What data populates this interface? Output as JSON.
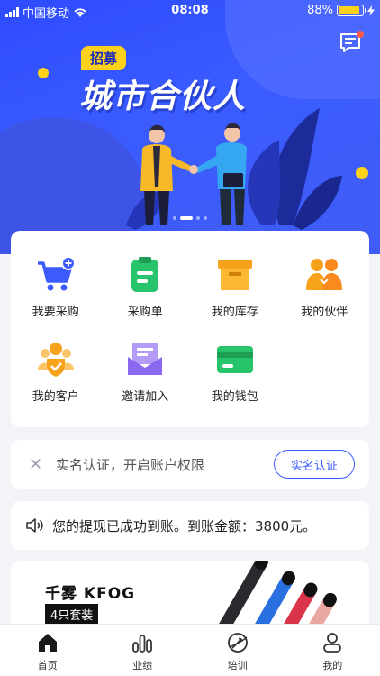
{
  "status_bar": {
    "carrier": "中国移动",
    "time": "08:08",
    "battery": "88%"
  },
  "banner": {
    "tag": "招募",
    "headline": "城市合伙人",
    "slide_count": 4,
    "active_slide": 1
  },
  "menu": {
    "items": [
      {
        "label": "我要采购",
        "icon": "shopping-cart-plus-icon"
      },
      {
        "label": "采购单",
        "icon": "clipboard-list-icon"
      },
      {
        "label": "我的库存",
        "icon": "inventory-box-icon"
      },
      {
        "label": "我的伙伴",
        "icon": "partners-icon"
      },
      {
        "label": "我的客户",
        "icon": "customer-shield-icon"
      },
      {
        "label": "邀请加入",
        "icon": "invitation-envelope-icon"
      },
      {
        "label": "我的钱包",
        "icon": "wallet-card-icon"
      }
    ]
  },
  "verify": {
    "text": "实名认证，开启账户权限",
    "button": "实名认证"
  },
  "notice": {
    "text": "您的提现已成功到账。到账金额：3800元。"
  },
  "promo": {
    "title": "千雾 KFOG",
    "tag": "4只套装"
  },
  "tabbar": {
    "items": [
      {
        "label": "首页",
        "icon": "home-icon",
        "active": true
      },
      {
        "label": "业绩",
        "icon": "bar-chart-icon",
        "active": false
      },
      {
        "label": "培训",
        "icon": "training-icon",
        "active": false
      },
      {
        "label": "我的",
        "icon": "profile-icon",
        "active": false
      }
    ]
  },
  "colors": {
    "primary": "#3b5bfd",
    "accent": "#ffd11a",
    "green": "#27c46b",
    "orange": "#f7a21b",
    "purple": "#8b68f0"
  }
}
